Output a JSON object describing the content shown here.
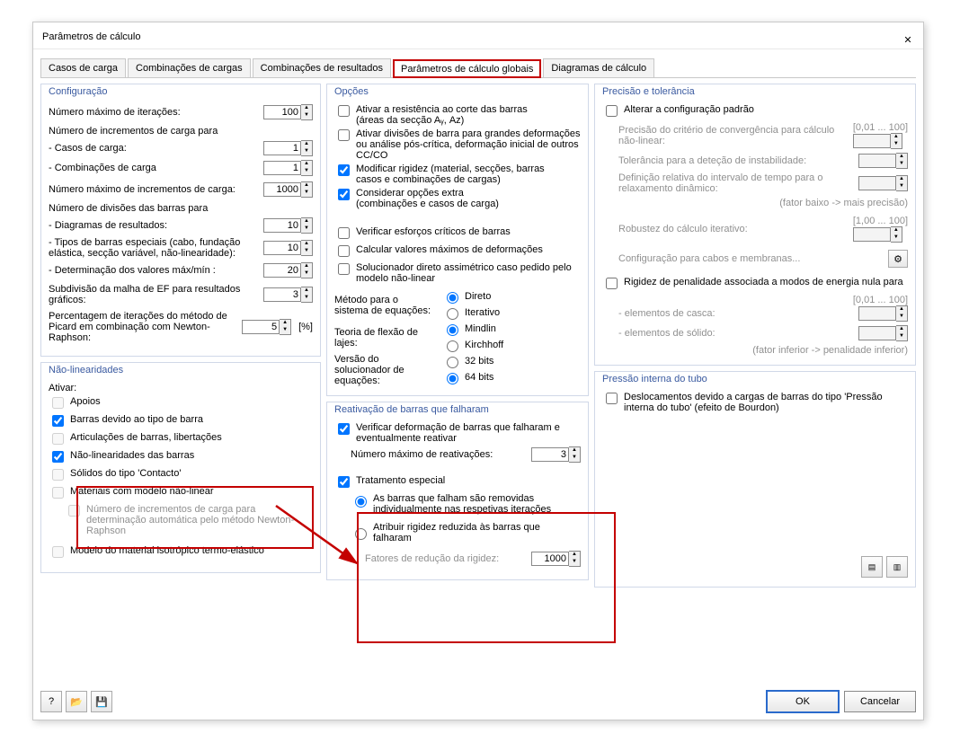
{
  "title": "Parâmetros de cálculo",
  "tabs": [
    "Casos de carga",
    "Combinações de cargas",
    "Combinações de resultados",
    "Parâmetros de cálculo globais",
    "Diagramas de cálculo"
  ],
  "config": {
    "title": "Configuração",
    "max_iter_label": "Número máximo de iterações:",
    "max_iter": "100",
    "incr_carga_label": "Número de incrementos de carga para",
    "casos_carga_label": "- Casos de carga:",
    "casos_carga": "1",
    "comb_carga_label": "- Combinações de carga",
    "comb_carga": "1",
    "max_incr_label": "Número máximo de incrementos de carga:",
    "max_incr": "1000",
    "div_barras_label": "Número de divisões das barras para",
    "diag_res_label": "- Diagramas de resultados:",
    "diag_res": "10",
    "tipos_label": "- Tipos de barras especiais (cabo, fundação elástica, secção variável, não-linearidade):",
    "tipos": "10",
    "det_label": "- Determinação dos valores máx/mín :",
    "det": "20",
    "sub_label": "Subdivisão da malha de EF para resultados gráficos:",
    "sub": "3",
    "picard_label": "Percentagem de iterações do método de Picard em combinação com Newton-Raphson:",
    "picard": "5",
    "picard_unit": "[%]"
  },
  "nonlin": {
    "title": "Não-linearidades",
    "activate": "Ativar:",
    "apoios": "Apoios",
    "barras_tipo": "Barras devido ao tipo de barra",
    "artic": "Articulações de barras, libertações",
    "nl_barras": "Não-linearidades das barras",
    "solidos": "Sólidos do tipo 'Contacto'",
    "mat_nl": "Materiais com modelo não-linear",
    "mat_nl_sub": "Número de incrementos de carga para determinação automática pelo método Newton-Raphson",
    "modelo_iso": "Modelo do material isotrópico termo-elástico"
  },
  "opcoes": {
    "title": "Opções",
    "a_cort": "Ativar a resistência ao corte das barras (áreas da secção Aᵧ, A<z>)",
    "a_cort2": "(áreas da secção Aᵧ, Aᴢ)",
    "a_div": "Ativar divisões de barra para grandes deformações ou análise pós-crítica, deformação inicial de outros CC/CO",
    "mod_rig1": "Modificar rigidez (material, secções, barras",
    "mod_rig2": "casos e combinações de cargas)",
    "cons_extra1": "Considerar opções extra",
    "cons_extra2": "(combinações e casos de carga)",
    "verif_esf": "Verificar esforços críticos de barras",
    "calc_max": "Calcular valores máximos de deformações",
    "sol_dir": "Solucionador direto assimétrico caso pedido pelo modelo não-linear",
    "met_lbl": "Método para o sistema de equações:",
    "met_direto": "Direto",
    "met_iter": "Iterativo",
    "teo_lbl": "Teoria de flexão de lajes:",
    "teo_mindlin": "Mindlin",
    "teo_kirch": "Kirchhoff",
    "ver_lbl": "Versão do solucionador de equações:",
    "ver_32": "32 bits",
    "ver_64": "64 bits"
  },
  "reat": {
    "title": "Reativação de barras que falharam",
    "verif": "Verificar deformação de barras que falharam e eventualmente reativar",
    "max_lbl": "Número máximo de reativações:",
    "max": "3",
    "trat": "Tratamento especial",
    "rad1": "As barras que falham são removidas individualmente nas respetivas iterações",
    "rad2": "Atribuir rigidez reduzida às barras que falharam",
    "fat_lbl": "Fatores de redução da rigidez:",
    "fat": "1000"
  },
  "prec": {
    "title": "Precisão e tolerância",
    "alt": "Alterar a configuração padrão",
    "crit_lbl": "Precisão do critério de convergência para cálculo não-linear:",
    "crit_rng": "[0,01 ... 100]",
    "tol_lbl": "Tolerância para a deteção de instabilidade:",
    "def_lbl": "Definição relativa do intervalo de tempo para o relaxamento dinâmico:",
    "def_note": "(fator baixo -> mais precisão)",
    "rob_lbl": "Robustez do cálculo iterativo:",
    "rob_rng": "[1,00 ... 100]",
    "cabos": "Configuração para cabos e membranas...",
    "rig_pen": "Rigidez de penalidade associada a modos de energia nula para",
    "pen_rng": "[0,01 ... 100]",
    "casca": "- elementos de casca:",
    "solido": "- elementos de sólido:",
    "pen_note": "(fator inferior -> penalidade inferior)"
  },
  "tubo": {
    "title": "Pressão interna do tubo",
    "chk": "Deslocamentos devido a cargas de barras do tipo 'Pressão interna do tubo' (efeito de Bourdon)"
  },
  "buttons": {
    "ok": "OK",
    "cancel": "Cancelar"
  }
}
